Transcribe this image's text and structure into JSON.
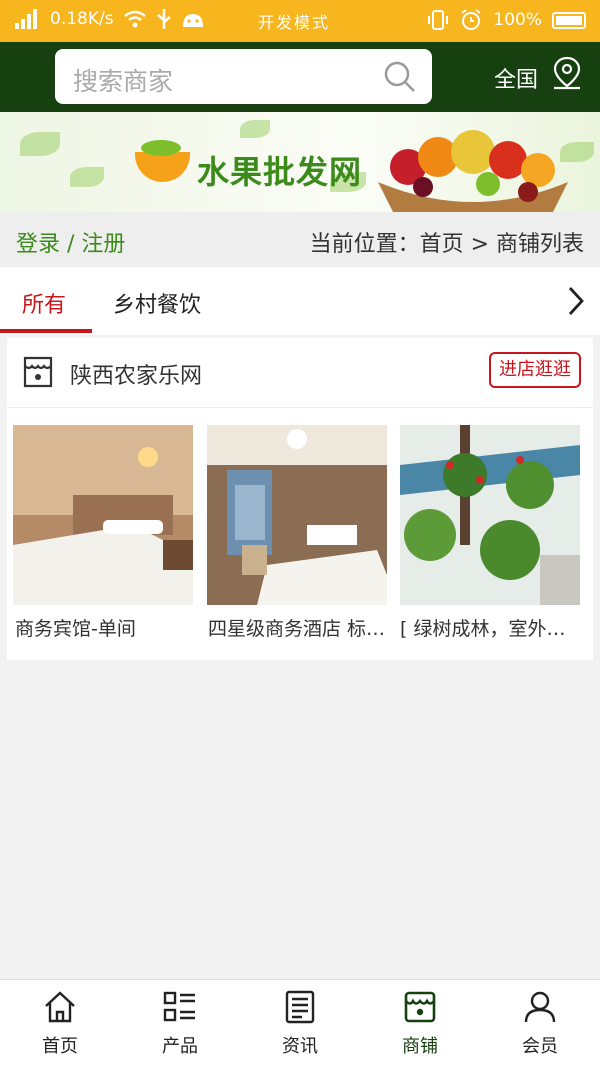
{
  "status_bar": {
    "speed": "0.18K/s",
    "mode": "开发模式",
    "battery": "100%"
  },
  "header": {
    "search_placeholder": "搜索商家",
    "region": "全国",
    "icons": [
      "search-icon",
      "location-icon"
    ]
  },
  "banner": {
    "title": "水果批发网"
  },
  "location_bar": {
    "login": "登录 / 注册",
    "breadcrumb": "当前位置：首页 > 商铺列表"
  },
  "tabs": {
    "items": [
      {
        "label": "所有",
        "active": true
      },
      {
        "label": "乡村餐饮",
        "active": false
      }
    ]
  },
  "shop": {
    "name": "陕西农家乐网",
    "enter_label": "进店逛逛",
    "products": [
      {
        "caption": "商务宾馆-单间"
      },
      {
        "caption": "四星级商务酒店 标准间"
      },
      {
        "caption": "[ 绿树成林，室外风景"
      }
    ]
  },
  "tabbar": {
    "items": [
      {
        "label": "首页",
        "icon": "home-icon"
      },
      {
        "label": "产品",
        "icon": "products-icon"
      },
      {
        "label": "资讯",
        "icon": "news-icon"
      },
      {
        "label": "商铺",
        "icon": "shop-icon",
        "active": true
      },
      {
        "label": "会员",
        "icon": "member-icon"
      }
    ]
  },
  "colors": {
    "status_bar": "#f7b51e",
    "header": "#16400f",
    "accent_red": "#c8161d",
    "accent_green": "#3b8a1b"
  }
}
